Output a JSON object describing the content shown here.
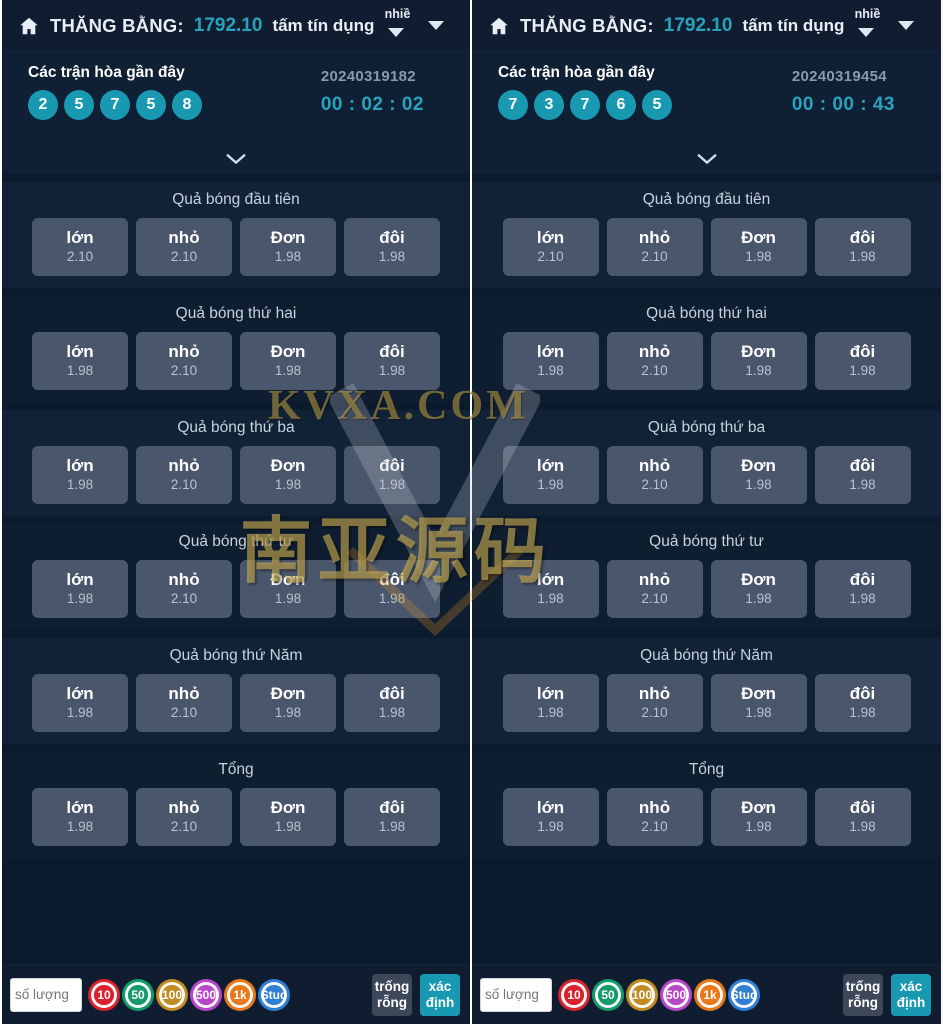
{
  "header": {
    "home_icon": "home-icon",
    "balance_label": "THĂNG BẰNG:",
    "balance_value": "1792.10",
    "credit_word": "tấm tín dụng",
    "credit_more": "nhiề",
    "caret_icon": "caret-down-icon"
  },
  "panels": [
    {
      "recent_title": "Các trận hòa gần đây",
      "recent_balls": [
        "2",
        "5",
        "7",
        "5",
        "8"
      ],
      "issue_id": "20240319182",
      "countdown": "00 : 02 : 02"
    },
    {
      "recent_title": "Các trận hòa gần đây",
      "recent_balls": [
        "7",
        "3",
        "7",
        "6",
        "5"
      ],
      "issue_id": "20240319454",
      "countdown": "00 : 00 : 43"
    }
  ],
  "expand_icon": "chevron-down-icon",
  "bet_sections": [
    {
      "title": "Quả bóng đầu tiên",
      "options": [
        {
          "label": "lớn",
          "odds": "2.10"
        },
        {
          "label": "nhỏ",
          "odds": "2.10"
        },
        {
          "label": "Đơn",
          "odds": "1.98"
        },
        {
          "label": "đôi",
          "odds": "1.98"
        }
      ]
    },
    {
      "title": "Quả bóng thứ hai",
      "options": [
        {
          "label": "lớn",
          "odds": "1.98"
        },
        {
          "label": "nhỏ",
          "odds": "2.10"
        },
        {
          "label": "Đơn",
          "odds": "1.98"
        },
        {
          "label": "đôi",
          "odds": "1.98"
        }
      ]
    },
    {
      "title": "Quả bóng thứ ba",
      "options": [
        {
          "label": "lớn",
          "odds": "1.98"
        },
        {
          "label": "nhỏ",
          "odds": "2.10"
        },
        {
          "label": "Đơn",
          "odds": "1.98"
        },
        {
          "label": "đôi",
          "odds": "1.98"
        }
      ]
    },
    {
      "title": "Quả bóng thứ tư",
      "options": [
        {
          "label": "lớn",
          "odds": "1.98"
        },
        {
          "label": "nhỏ",
          "odds": "2.10"
        },
        {
          "label": "Đơn",
          "odds": "1.98"
        },
        {
          "label": "đôi",
          "odds": "1.98"
        }
      ]
    },
    {
      "title": "Quả bóng thứ Năm",
      "options": [
        {
          "label": "lớn",
          "odds": "1.98"
        },
        {
          "label": "nhỏ",
          "odds": "2.10"
        },
        {
          "label": "Đơn",
          "odds": "1.98"
        },
        {
          "label": "đôi",
          "odds": "1.98"
        }
      ]
    },
    {
      "title": "Tổng",
      "options": [
        {
          "label": "lớn",
          "odds": "1.98"
        },
        {
          "label": "nhỏ",
          "odds": "2.10"
        },
        {
          "label": "Đơn",
          "odds": "1.98"
        },
        {
          "label": "đôi",
          "odds": "1.98"
        }
      ]
    }
  ],
  "bottom_bar": {
    "amount_placeholder": "số lượng",
    "amount_value": "",
    "chips": [
      {
        "label": "10",
        "color": "#d8232f"
      },
      {
        "label": "50",
        "color": "#149a6b"
      },
      {
        "label": "100",
        "color": "#c08b20"
      },
      {
        "label": "500",
        "color": "#b846c9"
      },
      {
        "label": "1k",
        "color": "#e8791a"
      },
      {
        "label": "Stud",
        "color": "#2f7fd4"
      }
    ],
    "clear_label_1": "trống",
    "clear_label_2": "rỗng",
    "confirm_label_1": "xác",
    "confirm_label_2": "định"
  },
  "watermark": {
    "text_en": "KVXA.COM",
    "text_cn": "南亚源码"
  },
  "colors": {
    "accent_teal": "#1999b1",
    "panel_bg": "#0d1b2e",
    "bet_button": "#4a566c"
  }
}
